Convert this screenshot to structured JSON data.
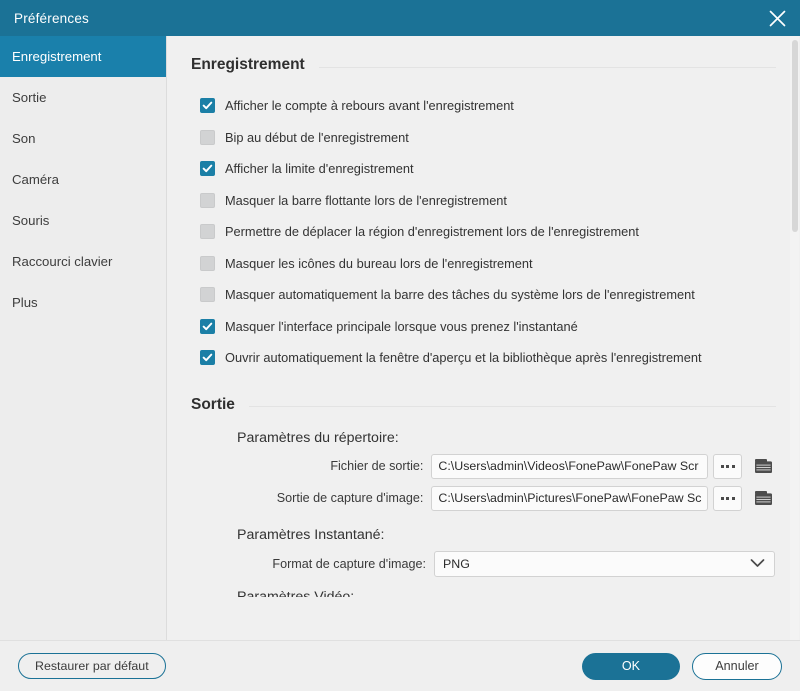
{
  "titlebar": {
    "title": "Préférences",
    "close_icon": "close-icon"
  },
  "sidebar": {
    "items": [
      {
        "label": "Enregistrement",
        "active": true
      },
      {
        "label": "Sortie",
        "active": false
      },
      {
        "label": "Son",
        "active": false
      },
      {
        "label": "Caméra",
        "active": false
      },
      {
        "label": "Souris",
        "active": false
      },
      {
        "label": "Raccourci clavier",
        "active": false
      },
      {
        "label": "Plus",
        "active": false
      }
    ]
  },
  "recording": {
    "section_title": "Enregistrement",
    "options": [
      {
        "label": "Afficher le compte à rebours avant l'enregistrement",
        "checked": true
      },
      {
        "label": "Bip au début de l'enregistrement",
        "checked": false
      },
      {
        "label": "Afficher la limite d'enregistrement",
        "checked": true
      },
      {
        "label": "Masquer la barre flottante lors de l'enregistrement",
        "checked": false
      },
      {
        "label": "Permettre de déplacer la région d'enregistrement lors de l'enregistrement",
        "checked": false
      },
      {
        "label": "Masquer les icônes du bureau lors de l'enregistrement",
        "checked": false
      },
      {
        "label": "Masquer automatiquement la barre des tâches du système lors de l'enregistrement",
        "checked": false
      },
      {
        "label": "Masquer l'interface principale lorsque vous prenez l'instantané",
        "checked": true
      },
      {
        "label": "Ouvrir automatiquement la fenêtre d'aperçu et la bibliothèque après l'enregistrement",
        "checked": true
      }
    ]
  },
  "output": {
    "section_title": "Sortie",
    "directory_heading": "Paramètres du répertoire:",
    "output_file": {
      "label": "Fichier de sortie:",
      "value": "C:\\Users\\admin\\Videos\\FonePaw\\FonePaw Scr",
      "browse_icon": "ellipsis-icon",
      "folder_icon": "folder-icon"
    },
    "screenshot_output": {
      "label": "Sortie de capture d'image:",
      "value": "C:\\Users\\admin\\Pictures\\FonePaw\\FonePaw Sc",
      "browse_icon": "ellipsis-icon",
      "folder_icon": "folder-icon"
    },
    "snapshot_heading": "Paramètres Instantané:",
    "screenshot_format": {
      "label": "Format de capture d'image:",
      "value": "PNG",
      "chevron_icon": "chevron-down-icon"
    },
    "video_heading_partial": "Paramètres Vidéo:"
  },
  "footer": {
    "restore_defaults": "Restaurer par défaut",
    "ok": "OK",
    "cancel": "Annuler"
  },
  "colors": {
    "titlebar": "#1b7296",
    "accent": "#1b7fa6",
    "sidebar_active": "#1a80ab",
    "checkbox_off": "#d2d3d4"
  }
}
